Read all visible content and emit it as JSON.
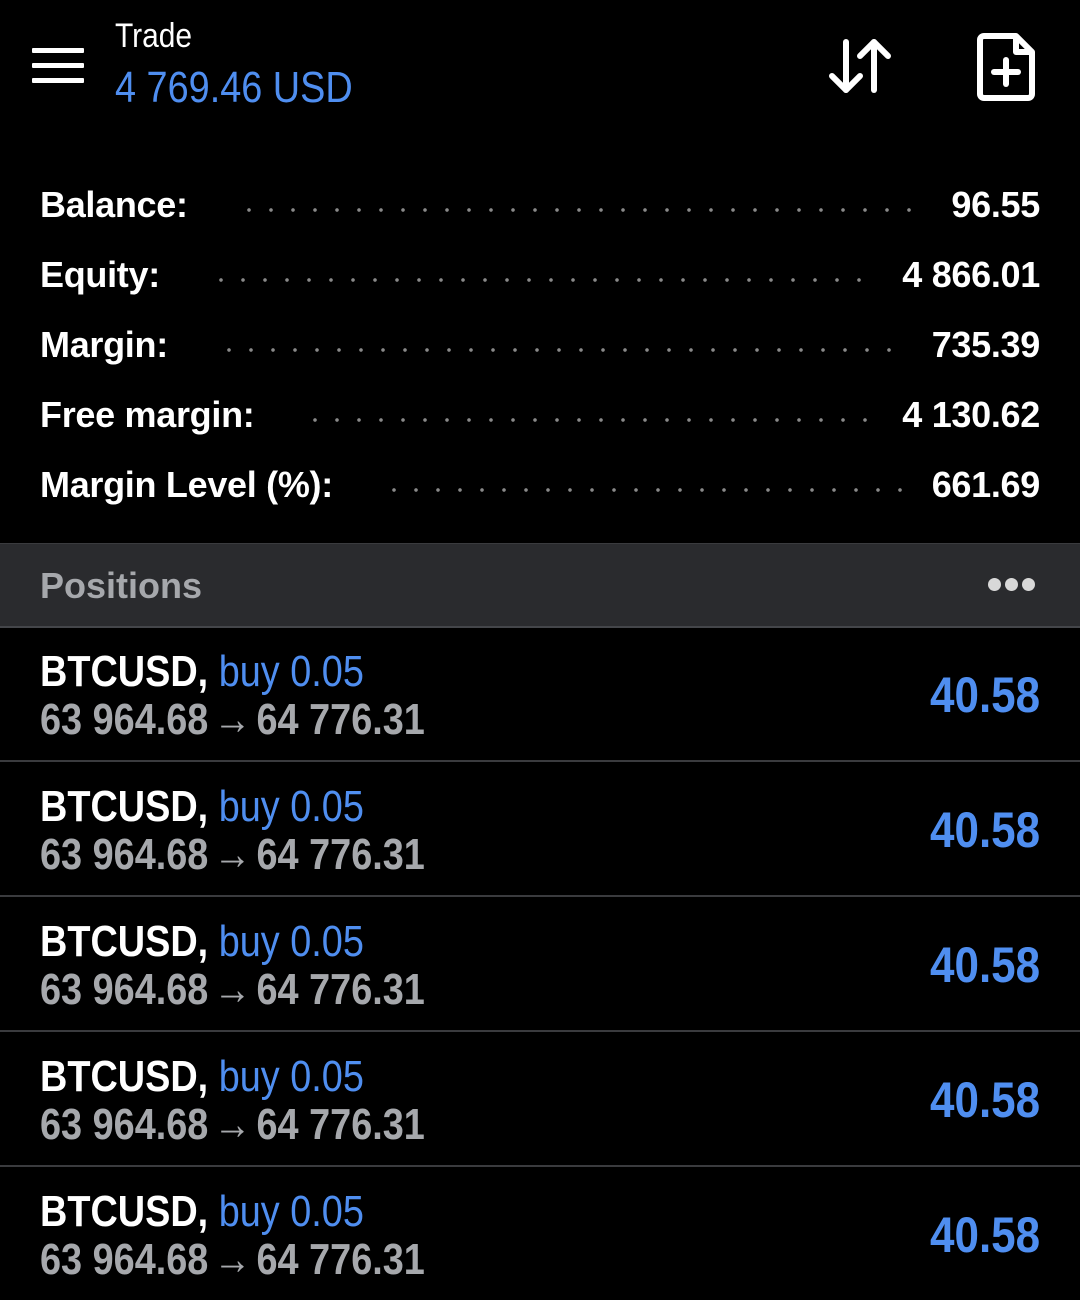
{
  "header": {
    "title": "Trade",
    "subtitle": "4 769.46 USD",
    "icons": {
      "menu": "hamburger-menu-icon",
      "sort": "sort-arrows-icon",
      "new_order": "file-plus-icon"
    }
  },
  "summary": [
    {
      "label": "Balance:",
      "value": "96.55"
    },
    {
      "label": "Equity:",
      "value": "4 866.01"
    },
    {
      "label": "Margin:",
      "value": "735.39"
    },
    {
      "label": "Free margin:",
      "value": "4 130.62"
    },
    {
      "label": "Margin Level (%):",
      "value": "661.69"
    }
  ],
  "positions": {
    "title": "Positions",
    "items": [
      {
        "symbol": "BTCUSD",
        "separator": ",",
        "type": "buy 0.05",
        "open_price": "63 964.68",
        "arrow": "→",
        "current_price": "64 776.31",
        "profit": "40.58"
      },
      {
        "symbol": "BTCUSD",
        "separator": ",",
        "type": "buy 0.05",
        "open_price": "63 964.68",
        "arrow": "→",
        "current_price": "64 776.31",
        "profit": "40.58"
      },
      {
        "symbol": "BTCUSD",
        "separator": ",",
        "type": "buy 0.05",
        "open_price": "63 964.68",
        "arrow": "→",
        "current_price": "64 776.31",
        "profit": "40.58"
      },
      {
        "symbol": "BTCUSD",
        "separator": ",",
        "type": "buy 0.05",
        "open_price": "63 964.68",
        "arrow": "→",
        "current_price": "64 776.31",
        "profit": "40.58"
      },
      {
        "symbol": "BTCUSD",
        "separator": ",",
        "type": "buy 0.05",
        "open_price": "63 964.68",
        "arrow": "→",
        "current_price": "64 776.31",
        "profit": "40.58"
      }
    ]
  },
  "colors": {
    "background": "#000000",
    "accent_blue": "#4f8ef0",
    "muted_text": "#a6a8ac",
    "section_header_bg": "#2a2b2e"
  }
}
